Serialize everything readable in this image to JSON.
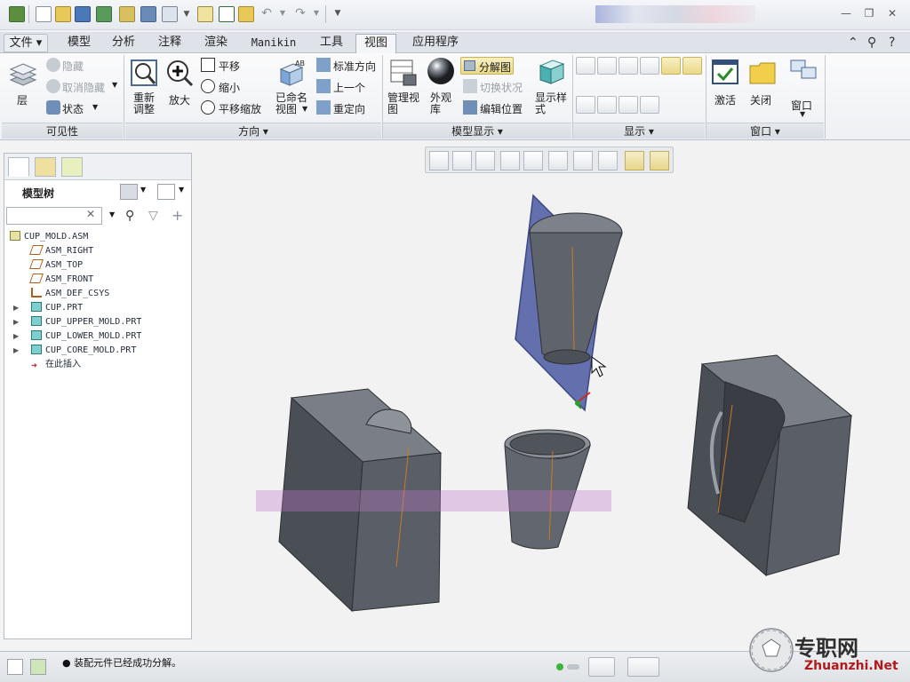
{
  "quick_access": {
    "icons": [
      "app-icon",
      "new-icon",
      "open-icon",
      "save-icon",
      "regenerate-icon",
      "window-icon",
      "close-window-icon",
      "mapkey-icon",
      "more-icon",
      "notebook-icon",
      "check-icon",
      "folder-icon",
      "undo-icon",
      "redo-icon",
      "customize-icon"
    ]
  },
  "tabs": {
    "file": "文件",
    "items": [
      "模型",
      "分析",
      "注释",
      "渲染",
      "Manikin",
      "工具",
      "视图",
      "应用程序"
    ],
    "active": "视图"
  },
  "ribbon": {
    "visibility": {
      "label": "可见性",
      "layer": "层",
      "hide": "隐藏",
      "unhide": "取消隐藏",
      "status": "状态"
    },
    "orientation": {
      "label": "方向",
      "refit": "重新\n调整",
      "zoom_in": "放大",
      "pan": "平移",
      "zoom_out": "缩小",
      "pan_zoom": "平移缩放",
      "named_views": "已命名\n视图",
      "standard_orient": "标准方向",
      "previous": "上一个",
      "reorient": "重定向"
    },
    "model_display": {
      "label": "模型显示",
      "manage_views": "管理视\n图",
      "appearance": "外观\n库",
      "explode": "分解图",
      "toggle_status": "切换状况",
      "edit_position": "编辑位置",
      "display_style": "显示样\n式"
    },
    "show": {
      "label": "显示"
    },
    "window": {
      "label": "窗口",
      "activate": "激活",
      "close": "关闭",
      "windows": "窗口"
    }
  },
  "model_tree": {
    "title": "模型树",
    "search_value": "",
    "items": [
      {
        "label": "CUP_MOLD.ASM",
        "icon": "assembly-icon",
        "indent": 0
      },
      {
        "label": "ASM_RIGHT",
        "icon": "datum-plane-icon",
        "indent": 1
      },
      {
        "label": "ASM_TOP",
        "icon": "datum-plane-icon",
        "indent": 1
      },
      {
        "label": "ASM_FRONT",
        "icon": "datum-plane-icon",
        "indent": 1
      },
      {
        "label": "ASM_DEF_CSYS",
        "icon": "csys-icon",
        "indent": 1
      },
      {
        "label": "CUP.PRT",
        "icon": "part-icon",
        "indent": 1
      },
      {
        "label": "CUP_UPPER_MOLD.PRT",
        "icon": "part-icon",
        "indent": 1
      },
      {
        "label": "CUP_LOWER_MOLD.PRT",
        "icon": "part-icon",
        "indent": 1
      },
      {
        "label": "CUP_CORE_MOLD.PRT",
        "icon": "part-icon",
        "indent": 1
      },
      {
        "label": "在此插入",
        "icon": "insert-here-icon",
        "indent": 1
      }
    ]
  },
  "status": {
    "message": "● 装配元件已经成功分解。"
  },
  "watermark": {
    "brand": "专职网",
    "site": "Zhuanzhi.Net"
  },
  "colors": {
    "mold_body": "#5c6068",
    "datum_plane": "#5866a8",
    "viewport_bg": "#f2f2f2"
  }
}
